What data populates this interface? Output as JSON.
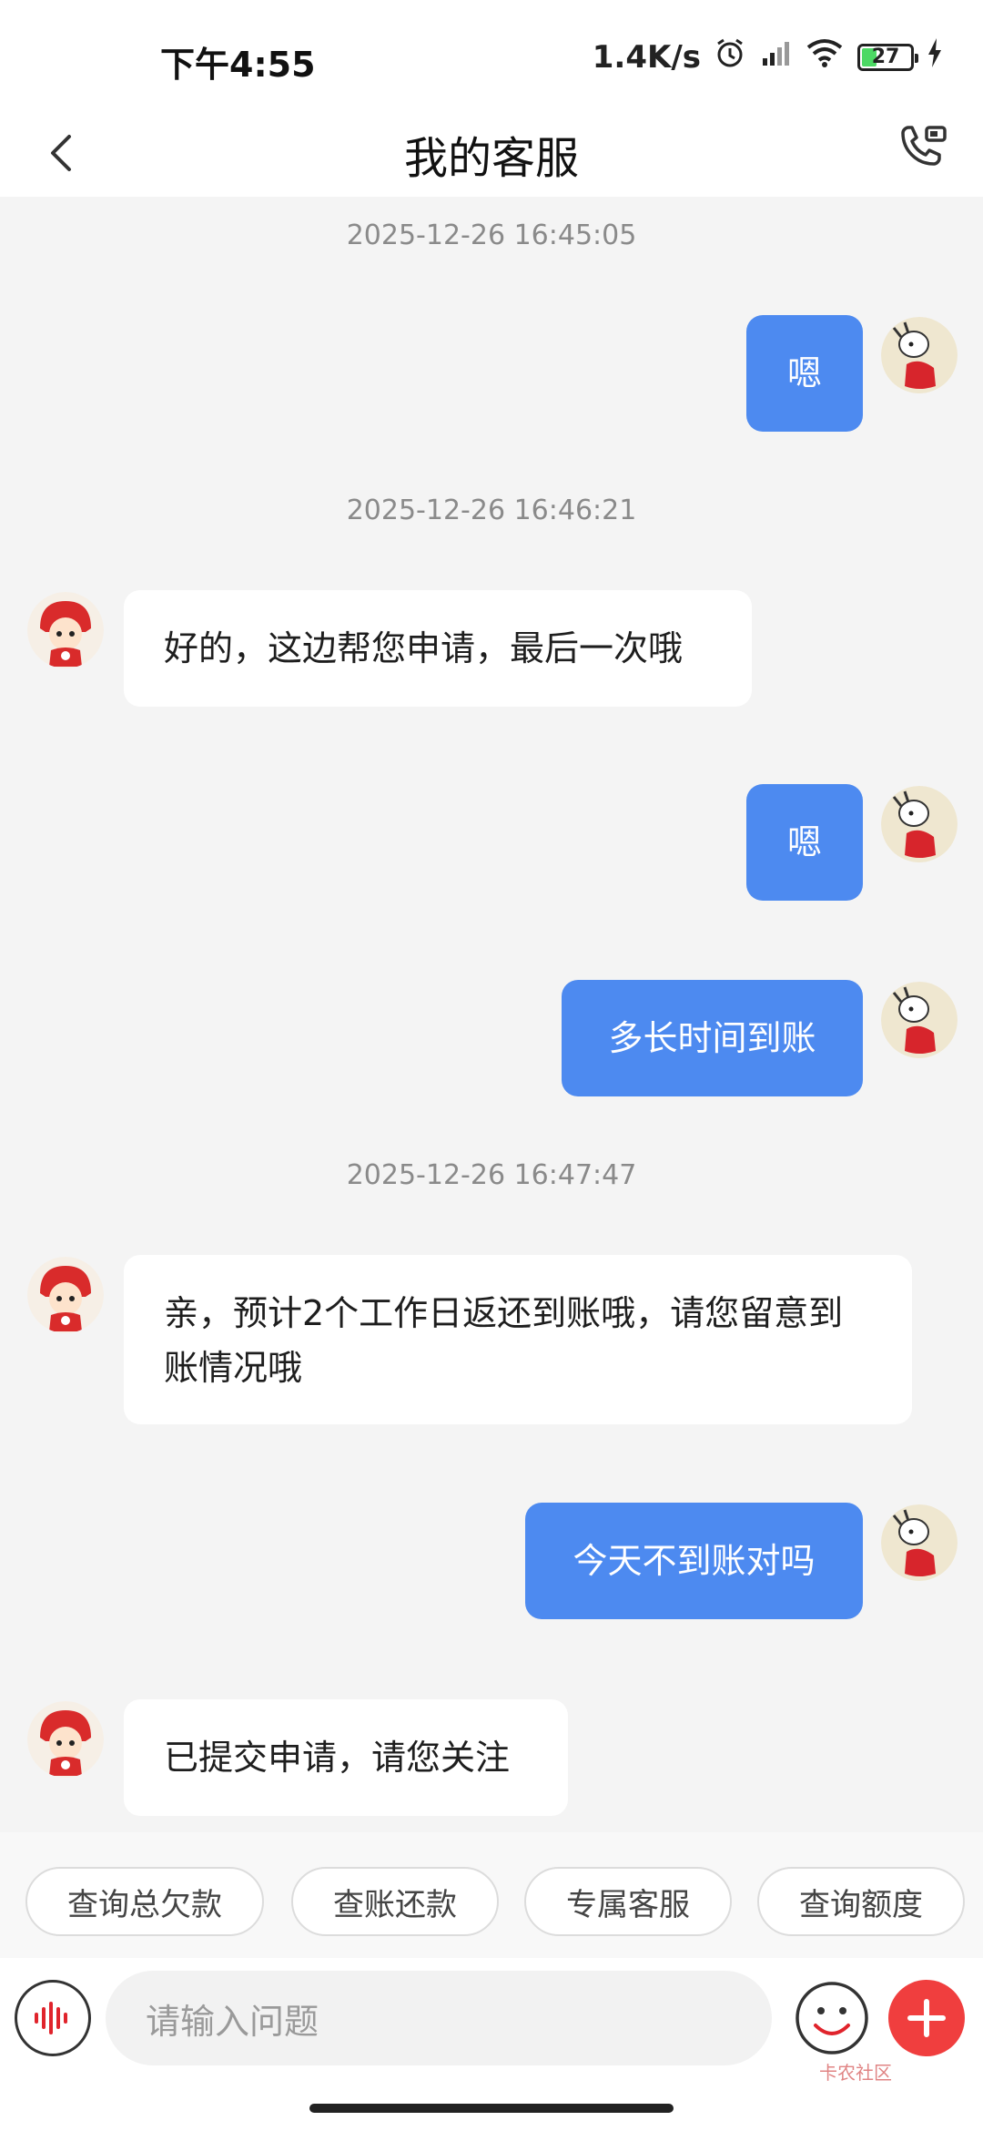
{
  "status": {
    "time": "下午4:55",
    "network_speed": "1.4K/s",
    "battery": "27"
  },
  "header": {
    "title": "我的客服"
  },
  "chat": {
    "timestamps": [
      "2025-12-26 16:45:05",
      "2025-12-26 16:46:21",
      "2025-12-26 16:47:47"
    ],
    "messages": [
      {
        "from": "user",
        "text": "嗯"
      },
      {
        "from": "agent",
        "text": "好的，这边帮您申请，最后一次哦"
      },
      {
        "from": "user",
        "text": "嗯"
      },
      {
        "from": "user",
        "text": "多长时间到账"
      },
      {
        "from": "agent",
        "text": "亲，预计2个工作日返还到账哦，请您留意到账情况哦"
      },
      {
        "from": "user",
        "text": "今天不到账对吗"
      },
      {
        "from": "agent",
        "text": "已提交申请，请您关注"
      }
    ]
  },
  "quick_replies": [
    "查询总欠款",
    "查账还款",
    "专属客服",
    "查询额度"
  ],
  "input": {
    "placeholder": "请输入问题"
  },
  "watermark": "卡农社区",
  "colors": {
    "user_bubble": "#4d8af0",
    "agent_bubble": "#ffffff",
    "plus_button": "#f03e3e"
  }
}
